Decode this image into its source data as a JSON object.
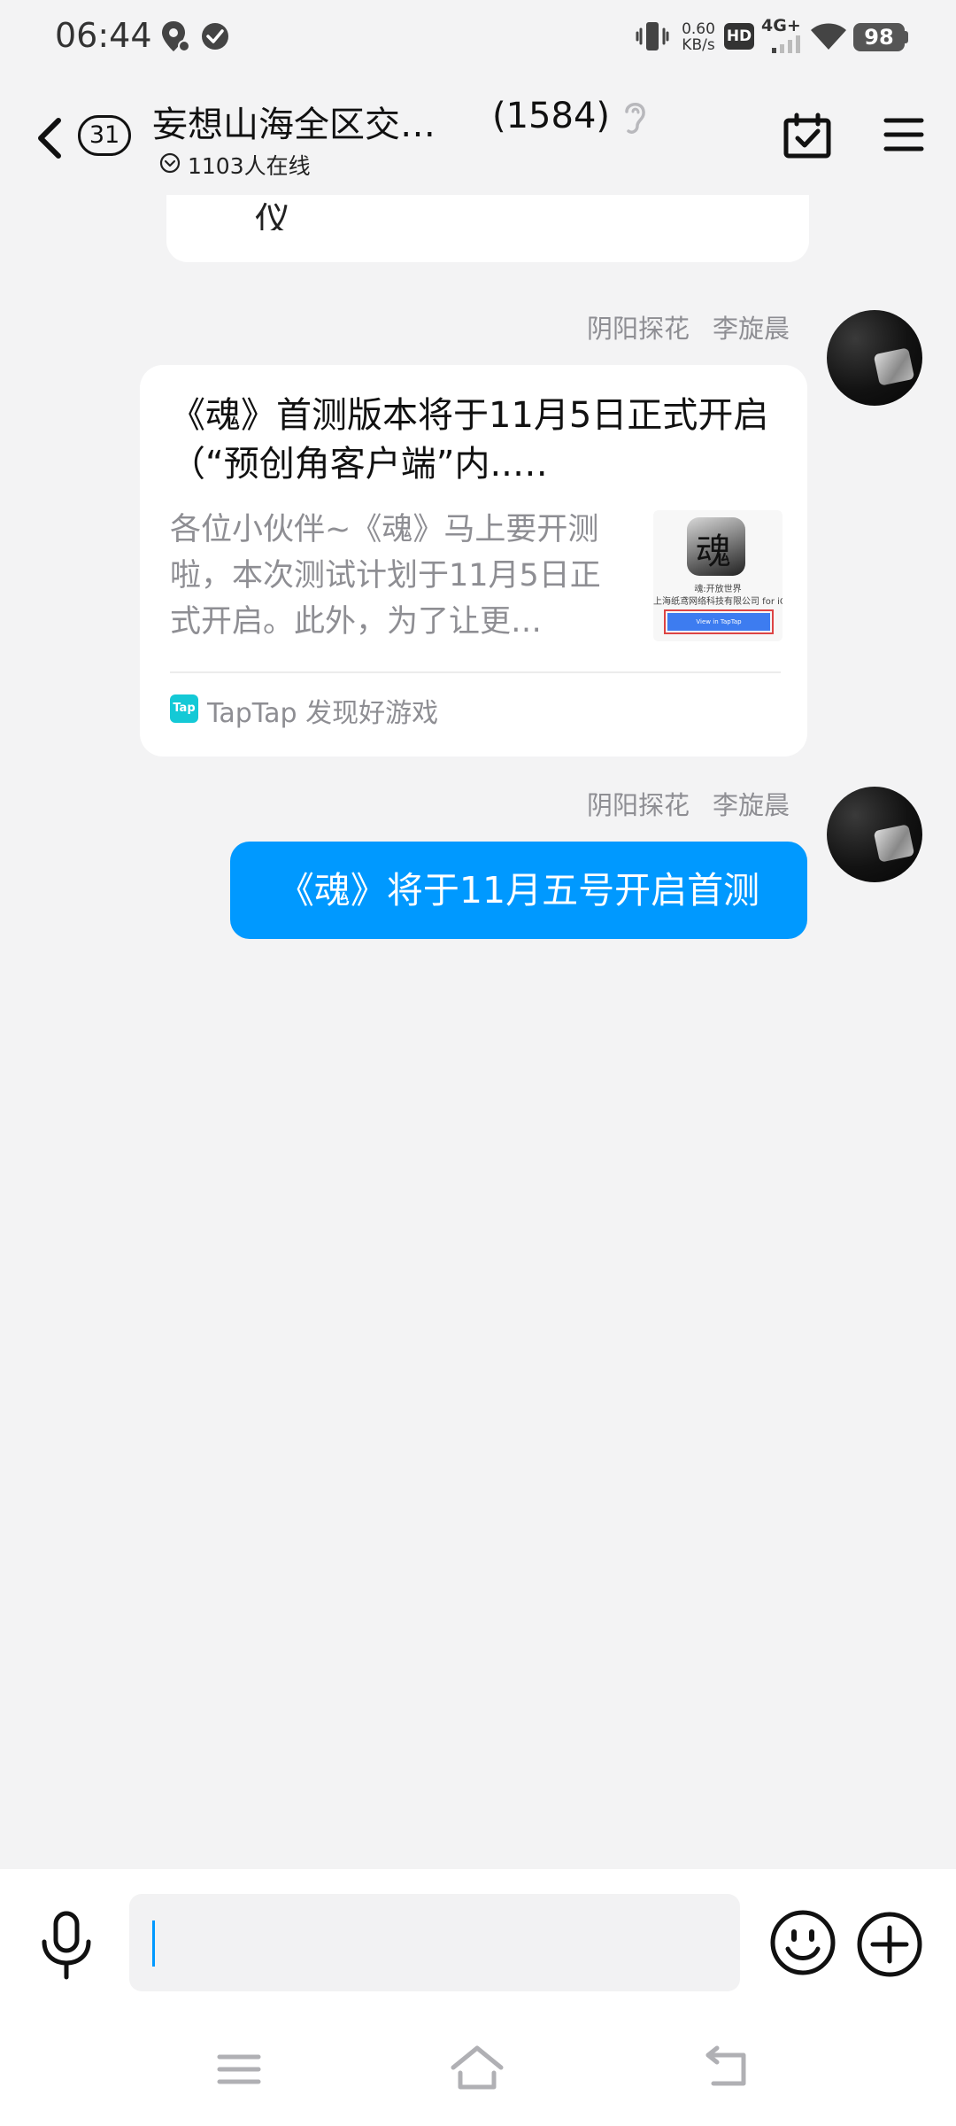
{
  "status_bar": {
    "time": "06:44",
    "net_speed_value": "0.60",
    "net_speed_unit": "KB/s",
    "hd_label": "HD",
    "network_label": "4G+",
    "battery": "98"
  },
  "header": {
    "unread_count": "31",
    "group_name": "妄想山海全区交…",
    "member_count": "(1584)",
    "online_text": "1103人在线"
  },
  "messages": {
    "previous_card_text": "仪",
    "link_message": {
      "sender_title": "阴阳探花",
      "sender_name": "李旋晨",
      "title": "《魂》首测版本将于11月5日正式开启（“预创角客户端”内..…",
      "description": "各位小伙伴~《魂》马上要开测啦，本次测试计划于11月5日正式开启。此外，为了让更…",
      "thumb_caption": "魂:开放世界",
      "thumb_company": "上海纸鸢网络科技有限公司 for iOS",
      "thumb_button": "View in TapTap",
      "source_icon_text": "Tap",
      "source": "TapTap 发现好游戏"
    },
    "text_message": {
      "sender_title": "阴阳探花",
      "sender_name": "李旋晨",
      "text": "《魂》将于11月五号开启首测"
    }
  },
  "input_bar": {
    "value": "",
    "placeholder": ""
  },
  "colors": {
    "accent": "#0099ff",
    "background": "#f3f3f4",
    "secondary_text": "#8e8e93",
    "taptap": "#14c9d6"
  },
  "icons": [
    "location-icon",
    "check-circle-icon",
    "vibrate-icon",
    "wifi-icon",
    "back-chevron-icon",
    "ear-icon",
    "chevron-down-circle-icon",
    "calendar-check-icon",
    "hamburger-menu-icon",
    "microphone-icon",
    "smile-icon",
    "plus-circle-icon",
    "nav-menu-icon",
    "nav-home-icon",
    "nav-back-icon"
  ]
}
